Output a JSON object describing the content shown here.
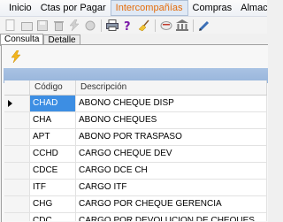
{
  "menu": {
    "items": [
      {
        "label": "Inicio"
      },
      {
        "label": "Ctas por Pagar"
      },
      {
        "label": "Intercompañías"
      },
      {
        "label": "Compras"
      },
      {
        "label": "Almacén y de"
      }
    ],
    "active_index": 2
  },
  "toolbar": {
    "icons": [
      "new-icon",
      "open-icon",
      "save-icon",
      "delete-icon",
      "lightning-icon",
      "record-icon",
      "print-icon",
      "help-icon",
      "broom-icon",
      "calendar-icon",
      "bank-icon",
      "pen-icon"
    ]
  },
  "tabs": [
    {
      "label": "Consulta",
      "selected": true
    },
    {
      "label": "Detalle",
      "selected": false
    }
  ],
  "grid": {
    "columns": [
      "Código",
      "Descripción"
    ],
    "rows": [
      {
        "code": "CHAD",
        "desc": "ABONO CHEQUE DISP",
        "selected": true
      },
      {
        "code": "CHA",
        "desc": "ABONO CHEQUES"
      },
      {
        "code": "APT",
        "desc": "ABONO POR TRASPASO"
      },
      {
        "code": "CCHD",
        "desc": "CARGO CHEQUE DEV"
      },
      {
        "code": "CDCE",
        "desc": "CARGO DCE CH"
      },
      {
        "code": "ITF",
        "desc": "CARGO ITF"
      },
      {
        "code": "CHG",
        "desc": "CARGO POR CHEQUE GERENCIA"
      },
      {
        "code": "CDC",
        "desc": "CARGO POR DEVOLUCION DE CHEQUES"
      }
    ]
  },
  "colors": {
    "accent": "#e46c0a",
    "selection": "#3d8ee3",
    "group_bar": "#a9c2e3"
  }
}
